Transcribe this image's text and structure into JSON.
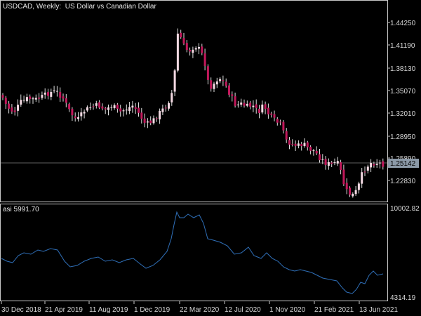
{
  "window": {
    "symbol": "USDCAD",
    "timeframe": "Weekly:",
    "description": "US Dollar vs Canadian Dollar",
    "title": "USDCAD, Weekly:  US Dollar vs Canadian Dollar"
  },
  "colors": {
    "background": "#000000",
    "frame": "#c8c8c8",
    "bull_candle": "#f3d9e2",
    "bear_candle": "#c2185b",
    "wick": "#e0e0e0",
    "price_line": "#606060",
    "indicator_line": "#2f6fb8",
    "price_label_bg": "#8c9aa8",
    "axis_text": "#d8d8d8"
  },
  "price_axis": {
    "labels": [
      "1.44250",
      "1.41190",
      "1.38130",
      "1.35070",
      "1.32010",
      "1.28950",
      "1.25890",
      "1.22830"
    ],
    "current_price": "1.25142"
  },
  "indicator": {
    "label": "asi 5991.70",
    "axis_labels": [
      "10002.82",
      "4314.19"
    ]
  },
  "time_axis": {
    "labels": [
      "30 Dec 2018",
      "21 Apr 2019",
      "11 Aug 2019",
      "1 Dec 2019",
      "22 Mar 2020",
      "12 Jul 2020",
      "1 Nov 2020",
      "21 Feb 2021",
      "13 Jun 2021"
    ]
  }
}
